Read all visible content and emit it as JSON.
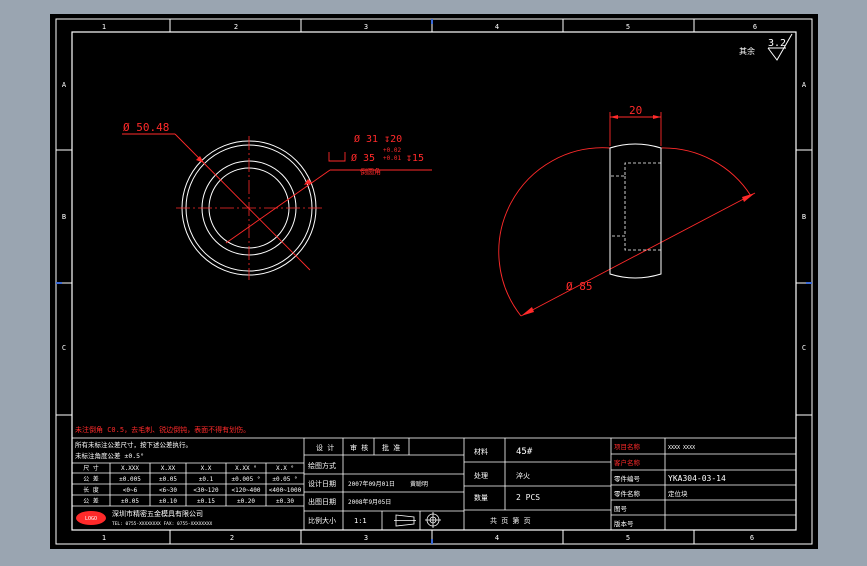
{
  "colors": {
    "viewport": "#9aa5b1",
    "sheet": "#000000",
    "line": "#ffffff",
    "dim": "#ff2a2a",
    "center": "#ff2a2a"
  },
  "border": {
    "top_marks": [
      "1",
      "2",
      "3",
      "4",
      "5",
      "6"
    ],
    "bottom_marks": [
      "1",
      "2",
      "3",
      "4",
      "5",
      "6"
    ],
    "left_marks": [
      "A",
      "B",
      "C"
    ],
    "right_marks": [
      "A",
      "B",
      "C"
    ]
  },
  "roughness": {
    "label": "其余",
    "value": "3.2"
  },
  "dims": {
    "outer_dia": "Ø 50.48",
    "bore_line1": "Ø 31 ↧20",
    "bore_tol_upper": "+0.02",
    "bore_tol_lower": "+0.01",
    "bore_line2": "Ø 35",
    "bore_depth": "↧15",
    "bore_note": "倒圆角",
    "width": "20",
    "sphere_dia": "Ø 85"
  },
  "tech_note": "未注倒角 C0.5，去毛刺、锐边倒钝，表面不得有划伤。",
  "tolerance": {
    "intro_line1": "所有未标注公差尺寸，按下述公差执行。",
    "intro_line2": "未标注角度公差 ±0.5°",
    "headers": [
      "尺 寸",
      "X.XXX",
      "X.XX",
      "X.X",
      "X.XX °",
      "X.X °"
    ],
    "rows": [
      [
        "公 差",
        "±0.005",
        "±0.05",
        "±0.1",
        "±0.005 °",
        "±0.05 °"
      ],
      [
        "长 度",
        "<0~6",
        "<6~30",
        "<30~120",
        "<120~400",
        "<400~1000"
      ],
      [
        "公 差",
        "±0.05",
        "±0.10",
        "±0.15",
        "±0.20",
        "±0.30"
      ]
    ],
    "company": "深圳市精密五金模具有限公司",
    "company_sub": "TEL: 0755-XXXXXXXX  FAX: 0755-XXXXXXXX"
  },
  "signoff": {
    "headers": [
      "设 计",
      "审 核",
      "批 准"
    ],
    "row_labels": [
      "绘图方式",
      "设计日期",
      "出图日期"
    ],
    "design_date": "2007年09月01日",
    "designer": "黄聪明",
    "issue_date": "2008年9月05日",
    "scale_label": "比例大小",
    "scale_value": "1:1",
    "view_label": "第 一 视 角"
  },
  "material": {
    "label_material": "材料",
    "material": "45#",
    "label_treatment": "处理",
    "treatment": "淬火",
    "label_qty": "数量",
    "qty": "2  PCS",
    "label_page": "共 页 第 页"
  },
  "part_info": {
    "label_project": "项目名称",
    "project": "XXXX XXXX",
    "label_customer": "客户名称",
    "customer": "",
    "label_part_no": "零件编号",
    "part_no": "YKA304-03-14",
    "label_part_name": "零件名称",
    "part_name": "定位块",
    "label_drawing": "图号",
    "label_revision": "版本号"
  }
}
